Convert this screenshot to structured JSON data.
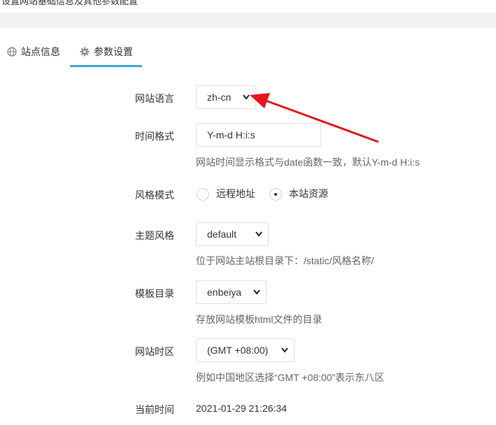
{
  "top_cut": {
    "text": "设置网站基础信息及其他参数配置"
  },
  "tabs": [
    {
      "label": "站点信息",
      "icon": "globe-icon"
    },
    {
      "label": "参数设置",
      "icon": "gear-icon",
      "active": true
    }
  ],
  "accent_color": "#3da8d8",
  "form": {
    "language": {
      "label": "网站语言",
      "value": "zh-cn"
    },
    "time_format": {
      "label": "时间格式",
      "value": "Y-m-d H:i:s",
      "hint": "网站时间显示格式与date函数一致，默认Y-m-d H:i:s"
    },
    "style_mode": {
      "label": "风格模式",
      "options": [
        "远程地址",
        "本站资源"
      ],
      "selected": "本站资源"
    },
    "theme": {
      "label": "主题风格",
      "value": "default",
      "hint": "位于网站主站根目录下：/static/风格名称/"
    },
    "template_dir": {
      "label": "模板目录",
      "value": "enbeiya",
      "hint": "存放网站模板html文件的目录"
    },
    "timezone": {
      "label": "网站时区",
      "value": "(GMT +08:00)",
      "hint": "例如中国地区选择“GMT +08:00”表示东八区"
    },
    "current_time": {
      "label": "当前时间",
      "value": "2021-01-29 21:26:34"
    }
  },
  "annotation_arrow_color": "#e8141b"
}
